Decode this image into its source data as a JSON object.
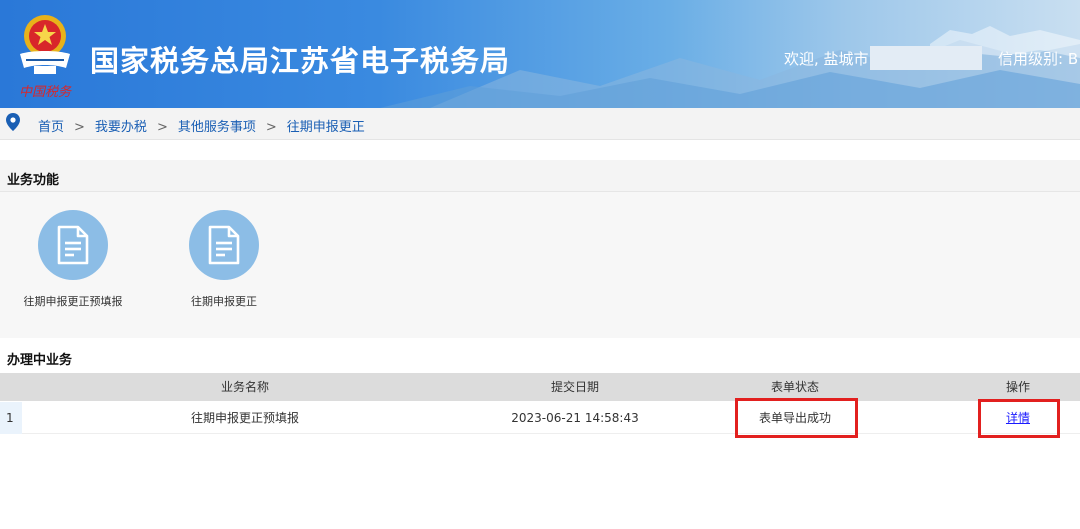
{
  "header": {
    "seal_text": "中国税务",
    "site_title": "国家税务总局江苏省电子税务局",
    "welcome": "欢迎, 盐城市",
    "credit_label": "信用级别: B"
  },
  "breadcrumb": {
    "items": [
      "首页",
      "我要办税",
      "其他服务事项",
      "往期申报更正"
    ],
    "separator": ">"
  },
  "business_functions": {
    "title": "业务功能",
    "items": [
      {
        "label": "往期申报更正预填报",
        "icon": "document-icon"
      },
      {
        "label": "往期申报更正",
        "icon": "document-icon"
      }
    ]
  },
  "in_progress": {
    "title": "办理中业务",
    "columns": [
      "业务名称",
      "提交日期",
      "表单状态",
      "操作"
    ],
    "rows": [
      {
        "index": "1",
        "name": "往期申报更正预填报",
        "date": "2023-06-21 14:58:43",
        "status": "表单导出成功",
        "action": "详情"
      }
    ]
  },
  "colors": {
    "banner_blue": "#2a78d8",
    "icon_circle": "#8cbde6",
    "link": "#1a5fb4",
    "highlight_red": "#e2201f"
  }
}
